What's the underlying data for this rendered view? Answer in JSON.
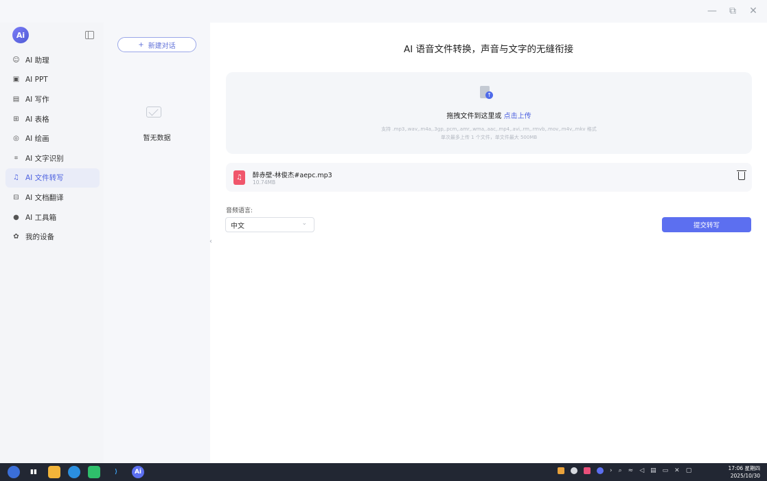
{
  "window": {
    "minimize_icon": "minimize-icon",
    "restore_icon": "restore-icon",
    "close_icon": "close-icon"
  },
  "sidebar": {
    "logo_text": "Ai",
    "items": [
      {
        "label": "AI 助理",
        "icon": "robot-icon"
      },
      {
        "label": "AI PPT",
        "icon": "ppt-icon"
      },
      {
        "label": "AI 写作",
        "icon": "writing-icon"
      },
      {
        "label": "AI 表格",
        "icon": "table-icon"
      },
      {
        "label": "AI 绘画",
        "icon": "paint-icon"
      },
      {
        "label": "AI 文字识别",
        "icon": "ocr-icon"
      },
      {
        "label": "AI 文件转写",
        "icon": "transcribe-icon"
      },
      {
        "label": "AI 文档翻译",
        "icon": "translate-icon"
      },
      {
        "label": "AI 工具箱",
        "icon": "toolbox-icon"
      },
      {
        "label": "我的设备",
        "icon": "device-icon"
      }
    ],
    "active_index": 6
  },
  "history": {
    "new_chat_label": "新建对话",
    "empty_text": "暂无数据"
  },
  "main": {
    "title": "AI 语音文件转换，声音与文字的无缝衔接",
    "upload": {
      "hint_prefix": "拖拽文件到这里或",
      "hint_link": "点击上传",
      "formats": "支持 .mp3,.wav,.m4a,.3gp,.pcm,.amr,.wma,.aac,.mp4,.avi,.rm,.rmvb,.mov,.m4v,.mkv 格式",
      "limits": "单次最多上传 1 个文件，单文件最大 500MB"
    },
    "file": {
      "name": "醉赤壁-林俊杰#aepc.mp3",
      "size": "10.74MB"
    },
    "language": {
      "label": "音频语言:",
      "selected": "中文"
    },
    "submit_label": "提交转写"
  },
  "taskbar": {
    "time": "17:06 星期四",
    "date": "2025/10/30",
    "apps": [
      {
        "name": "start-icon",
        "color": "#3b6fd8",
        "text": ""
      },
      {
        "name": "taskview-icon",
        "color": "#222733",
        "text": "▮▮"
      },
      {
        "name": "app-yellow-icon",
        "color": "#f2b43a",
        "text": ""
      },
      {
        "name": "browser-icon",
        "color": "#2b8fe0",
        "text": ""
      },
      {
        "name": "chat-app-icon",
        "color": "#2fbf6b",
        "text": ""
      },
      {
        "name": "vscode-icon",
        "color": "#2a7fd6",
        "text": "⟩"
      },
      {
        "name": "ai-app-icon",
        "color": "#5c6ff0",
        "text": "Ai"
      }
    ]
  }
}
